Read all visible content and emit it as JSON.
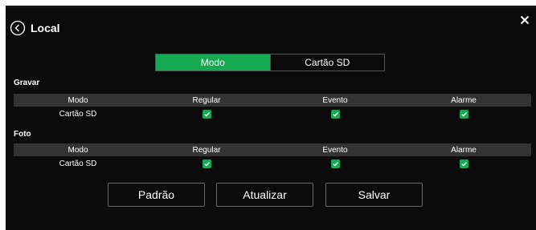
{
  "header": {
    "title": "Local"
  },
  "tabs": [
    {
      "label": "Modo",
      "active": true
    },
    {
      "label": "Cartão SD",
      "active": false
    }
  ],
  "sections": [
    {
      "label": "Gravar",
      "columns": [
        "Modo",
        "Regular",
        "Evento",
        "Alarme"
      ],
      "row": {
        "mode": "Cartão SD",
        "regular": true,
        "evento": true,
        "alarme": true
      }
    },
    {
      "label": "Foto",
      "columns": [
        "Modo",
        "Regular",
        "Evento",
        "Alarme"
      ],
      "row": {
        "mode": "Cartão SD",
        "regular": true,
        "evento": true,
        "alarme": true
      }
    }
  ],
  "buttons": {
    "default": "Padrão",
    "refresh": "Atualizar",
    "save": "Salvar"
  },
  "colors": {
    "accent": "#17a852",
    "background": "#0b0b0b",
    "table_header": "#333333"
  },
  "icons": {
    "back": "back-circle-icon",
    "close": "close-icon",
    "check": "checkbox-checked-icon"
  }
}
